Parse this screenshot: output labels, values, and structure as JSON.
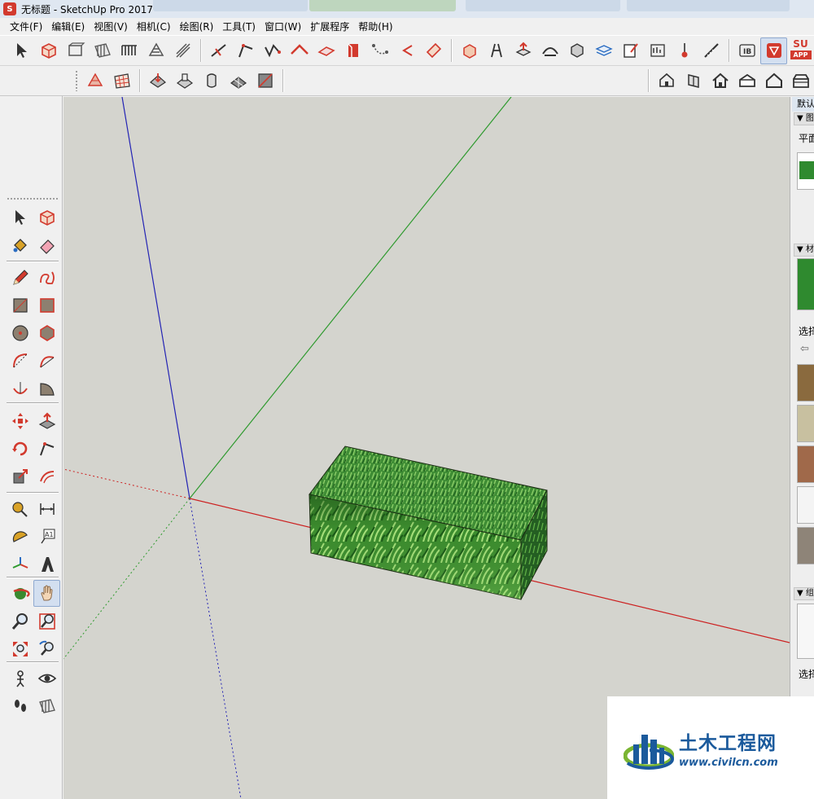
{
  "window": {
    "title": "无标题 - SketchUp Pro 2017",
    "app_icon": "sketchup-logo-icon",
    "brand_color": "#d23a2e"
  },
  "menu": [
    {
      "label": "文件(F)"
    },
    {
      "label": "编辑(E)"
    },
    {
      "label": "视图(V)"
    },
    {
      "label": "相机(C)"
    },
    {
      "label": "绘图(R)"
    },
    {
      "label": "工具(T)"
    },
    {
      "label": "窗口(W)"
    },
    {
      "label": "扩展程序"
    },
    {
      "label": "帮助(H)"
    }
  ],
  "toolbar_main": {
    "groups": [
      [
        "select-icon",
        "make-component-icon",
        "front-view-icon",
        "section-plane-icon",
        "section-display-icon",
        "section-fill-icon",
        "section-cuts-icon"
      ],
      [
        "line-icon",
        "follow-me-icon",
        "polyline-icon",
        "roof-icon",
        "offset-plane-icon",
        "paint-push-icon",
        "path-nodes-icon",
        "arc-path-icon",
        "tag-icon"
      ],
      [
        "3d-warehouse-icon",
        "extension-warehouse-icon",
        "upload-icon",
        "loft-icon",
        "cube-icon",
        "layer-stack-icon",
        "note-edit-icon",
        "dashboard-icon",
        "pin-icon",
        "measure-icon"
      ],
      [
        "render-ib-icon",
        "sketchup-ruby-icon",
        "su-app-icon"
      ]
    ],
    "su_app_text": "SU",
    "su_app_sub": "APP"
  },
  "toolbar_second": {
    "groups": [
      [
        "terrain-icon",
        "grid-icon"
      ],
      [
        "sandbox-smoove-icon",
        "sandbox-stamp-icon",
        "sandbox-drape-icon",
        "sandbox-detail-icon",
        "sandbox-flip-icon"
      ]
    ],
    "views": [
      "iso-view-icon",
      "right-view-icon",
      "home-view-icon",
      "top-view-icon",
      "back-view-icon",
      "bottom-view-icon"
    ]
  },
  "palette": {
    "rows": [
      [
        "select-arrow-icon",
        "make-component-icon"
      ],
      [
        "paint-bucket-icon",
        "eraser-icon"
      ],
      [
        "pencil-icon",
        "freehand-icon"
      ],
      [
        "rectangle-icon",
        "rotated-rectangle-icon"
      ],
      [
        "circle-icon",
        "polygon-icon"
      ],
      [
        "arc-icon",
        "two-point-arc-icon"
      ],
      [
        "three-point-arc-icon",
        "pie-icon"
      ],
      [
        "move-icon",
        "push-pull-icon"
      ],
      [
        "rotate-icon",
        "follow-me-icon"
      ],
      [
        "scale-icon",
        "offset-icon"
      ],
      [
        "tape-measure-icon",
        "dimension-icon"
      ],
      [
        "protractor-icon",
        "text-icon"
      ],
      [
        "axes-icon",
        "3d-text-icon"
      ],
      [
        "orbit-icon",
        "pan-icon"
      ],
      [
        "zoom-icon",
        "zoom-window-icon"
      ],
      [
        "zoom-extents-icon",
        "previous-view-icon"
      ],
      [
        "position-camera-icon",
        "look-around-icon"
      ],
      [
        "walk-icon",
        "section-plane-icon"
      ]
    ],
    "active_tool": "pan-icon",
    "text_tool_label": "A1"
  },
  "viewport": {
    "background": "#d4d4ce",
    "axis_colors": {
      "red": "#cc2020",
      "green": "#2e9a2e",
      "blue": "#2323b4"
    },
    "model": "grass-textured-box"
  },
  "tray": {
    "title": "默认面板",
    "panels": [
      {
        "head": "▼ 图元信息"
      },
      {
        "head": "▼ 材料"
      },
      {
        "head": "▼ 组件"
      }
    ],
    "labels": [
      "平面",
      "选择",
      "选择"
    ],
    "swatch_colors": [
      "#2f8a2f",
      "#8a6a3e",
      "#c8c0a0",
      "#a0694a",
      "#f4f4f4",
      "#8e8478"
    ]
  },
  "watermark": {
    "title": "土木工程网",
    "url": "www.civilcn.com",
    "color": "#1b5a9c"
  }
}
